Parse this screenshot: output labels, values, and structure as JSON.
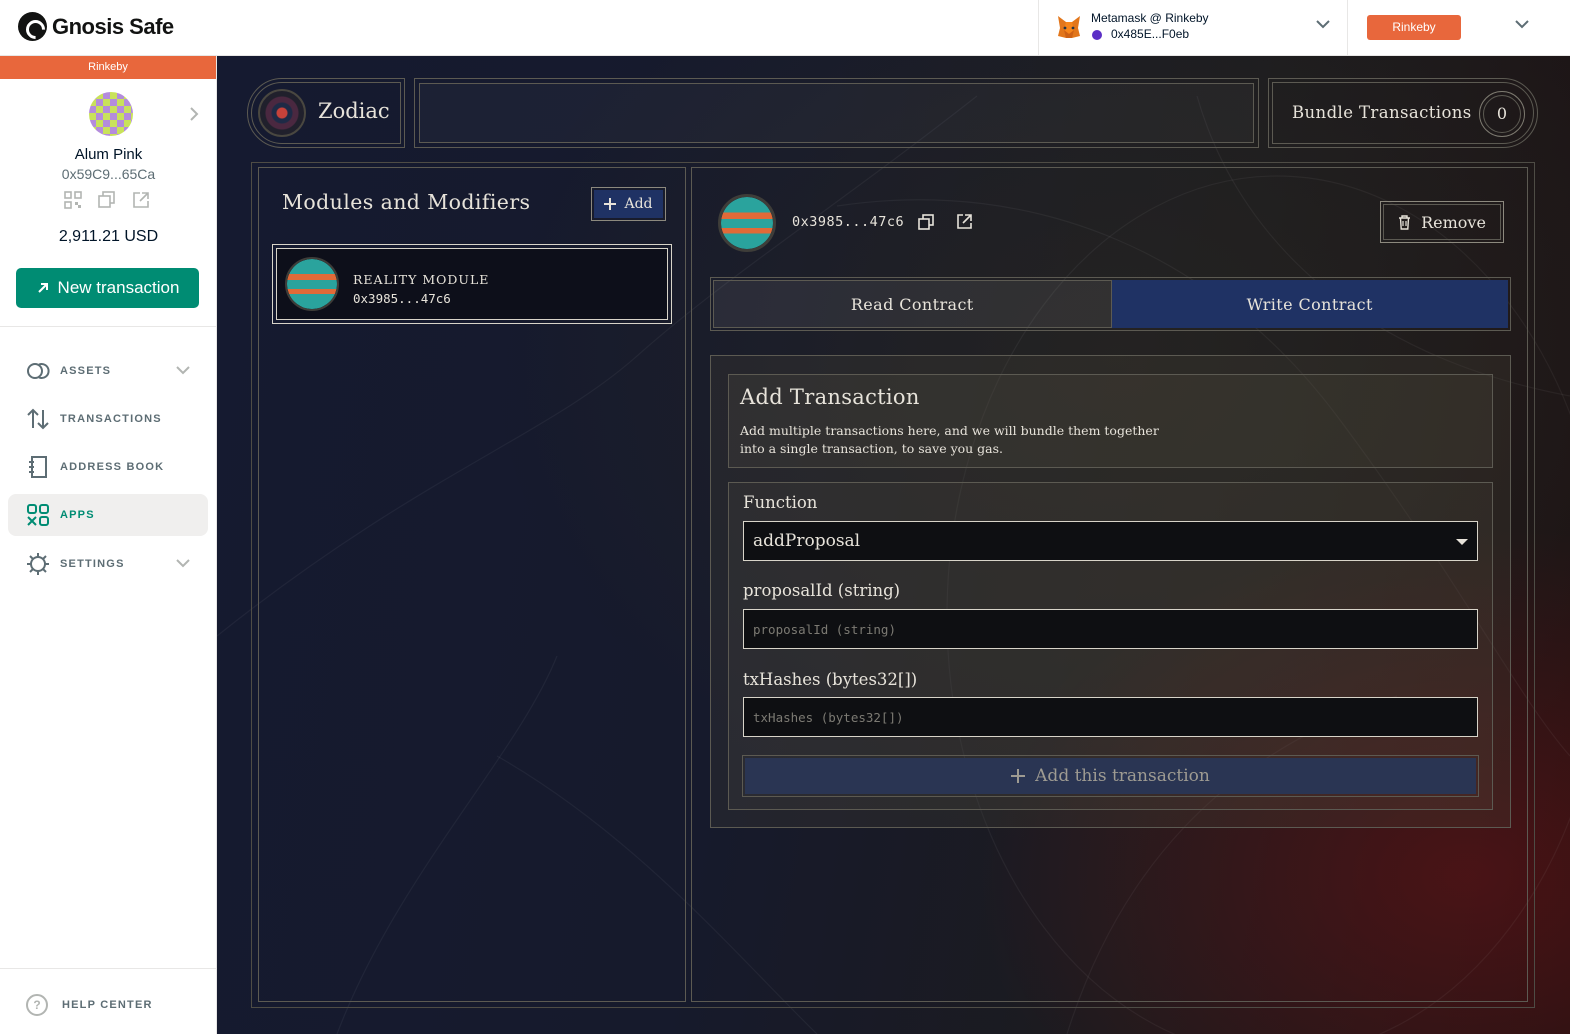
{
  "header": {
    "brand": "Gnosis Safe",
    "wallet": {
      "name": "Metamask @ Rinkeby",
      "address": "0x485E...F0eb"
    },
    "network_label": "Rinkeby"
  },
  "sidebar": {
    "network_strip": "Rinkeby",
    "safe_name": "Alum Pink",
    "safe_address": "0x59C9...65Ca",
    "balance": "2,911.21 USD",
    "new_transaction_label": "New transaction",
    "nav": [
      {
        "label": "ASSETS",
        "icon": "assets-icon",
        "has_chevron": true,
        "active": false
      },
      {
        "label": "TRANSACTIONS",
        "icon": "transactions-icon",
        "has_chevron": false,
        "active": false
      },
      {
        "label": "ADDRESS BOOK",
        "icon": "address-book-icon",
        "has_chevron": false,
        "active": false
      },
      {
        "label": "APPS",
        "icon": "apps-icon",
        "has_chevron": false,
        "active": true
      },
      {
        "label": "SETTINGS",
        "icon": "settings-icon",
        "has_chevron": true,
        "active": false
      }
    ],
    "help_label": "HELP CENTER"
  },
  "app": {
    "title": "Zodiac",
    "bundle_label": "Bundle Transactions",
    "bundle_count": "0",
    "modules": {
      "title": "Modules and Modifiers",
      "add_label": "Add",
      "items": [
        {
          "name": "REALITY MODULE",
          "address": "0x3985...47c6"
        }
      ]
    },
    "detail": {
      "address": "0x3985...47c6",
      "remove_label": "Remove",
      "tabs": [
        {
          "label": "Read Contract",
          "active": false
        },
        {
          "label": "Write Contract",
          "active": true
        }
      ],
      "add_transaction": {
        "title": "Add Transaction",
        "description": "Add multiple transactions here, and we will bundle them together into a single transaction, to save you gas."
      },
      "function_label": "Function",
      "function_value": "addProposal",
      "fields": [
        {
          "label": "proposalId (string)",
          "placeholder": "proposalId (string)"
        },
        {
          "label": "txHashes (bytes32[])",
          "placeholder": "txHashes (bytes32[])"
        }
      ],
      "submit_label": "Add this transaction"
    }
  },
  "colors": {
    "brand_green": "#008c73",
    "network_orange": "#e8673c",
    "zodiac_blue": "#1f3264"
  }
}
